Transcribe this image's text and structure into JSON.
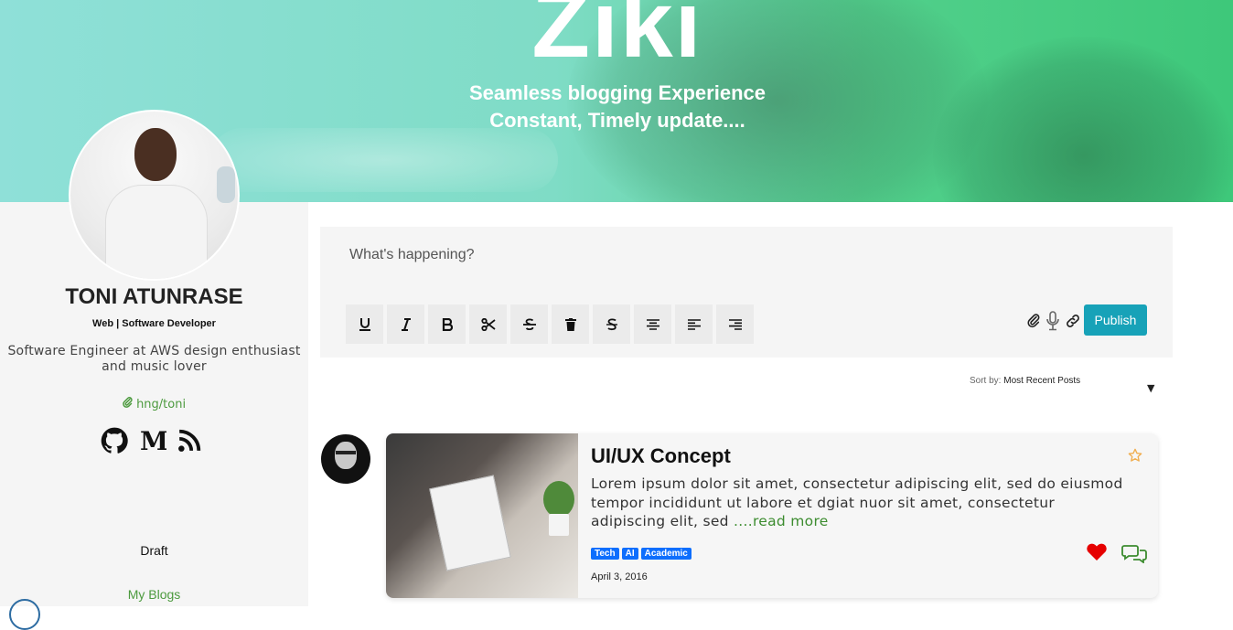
{
  "hero": {
    "brand": "Ziki",
    "tagline_line1": "Seamless blogging Experience",
    "tagline_line2": "Constant, Timely update...."
  },
  "profile": {
    "name": "TONI ATUNRASE",
    "role": "Web | Software Developer",
    "bio": "Software Engineer at AWS design enthusiast and music lover",
    "link_text": "hng/toni",
    "socials": [
      "github-icon",
      "medium-icon",
      "rss-icon"
    ]
  },
  "sidebar": {
    "draft_label": "Draft",
    "myblogs_label": "My Blogs"
  },
  "composer": {
    "placeholder": "What's happening?",
    "toolbar": [
      "underline-icon",
      "italic-icon",
      "bold-icon",
      "cut-icon",
      "strikethrough-icon",
      "trash-icon",
      "strike-s-icon",
      "align-center-icon",
      "align-left-icon",
      "align-right-icon"
    ],
    "publish_label": "Publish",
    "right_tools": [
      "attach-icon",
      "microphone-icon",
      "link-icon"
    ]
  },
  "sort": {
    "label": "Sort by:",
    "value": "Most Recent Posts"
  },
  "post": {
    "title": "UI/UX Concept",
    "excerpt": "Lorem ipsum dolor sit amet, consectetur adipiscing elit, sed do eiusmod tempor incididunt ut labore et dgiat nuor sit amet, consectetur adipiscing elit, sed ",
    "read_more": "....read more",
    "tags": [
      "Tech",
      "AI",
      "Academic"
    ],
    "date": "April 3, 2016"
  },
  "colors": {
    "accent": "#17a2b8",
    "link_green": "#4c9a3e",
    "tag_blue": "#0d6efd",
    "heart_red": "#e60000",
    "star_gold": "#f0ad4e"
  }
}
